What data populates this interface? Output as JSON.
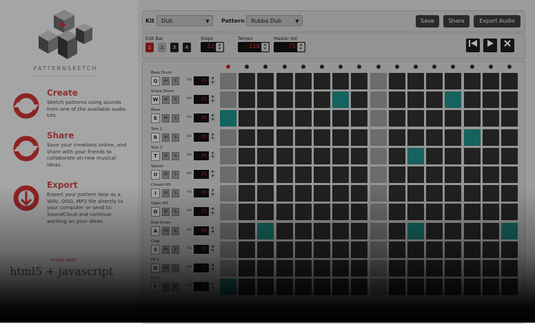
{
  "sidebar": {
    "logo_text": "PATTERNSKETCH",
    "features": [
      {
        "title": "Create",
        "text": "Sketch patterns using sounds from one of the available audio kits.",
        "icon": "cycle-arrows-icon"
      },
      {
        "title": "Share",
        "text": "Save your creations online, and share with your friends to collaborate on new musical ideas.",
        "icon": "share-cycle-icon"
      },
      {
        "title": "Export",
        "text": "Export your pattern loop as a WAV, OGG, MP3 file directly to your computer or send to SoundCloud and continue working on your ideas.",
        "icon": "download-arrow-icon"
      }
    ],
    "made_with": "made with",
    "tech": "html5 + javascript"
  },
  "toolbar": {
    "kit_label": "Kit",
    "kit_value": "Dub",
    "pattern_label": "Pattern",
    "pattern_value": "Rubba Dub",
    "save": "Save",
    "share": "Share",
    "export_audio": "Export Audio"
  },
  "controls": {
    "edit_bar_label": "Edit Bar",
    "bars": [
      "1",
      "2",
      "3",
      "4"
    ],
    "active_bar": "1",
    "steps_label": "Steps",
    "steps": "32",
    "tempo_label": "Tempo",
    "tempo": "110",
    "master_label": "Master Vol",
    "master": "75",
    "transport": [
      "rewind-icon",
      "play-icon",
      "close-icon"
    ]
  },
  "sequencer": {
    "active_step": 1,
    "mute_label": "M",
    "solo_label": "S",
    "vol_label": "Vol",
    "instruments": [
      {
        "name": "Bass Drum",
        "key": "Q",
        "vol": "75"
      },
      {
        "name": "Snare Drum",
        "key": "W",
        "vol": "75"
      },
      {
        "name": "Base",
        "key": "E",
        "vol": "35"
      },
      {
        "name": "Tom 1",
        "key": "R",
        "vol": "75"
      },
      {
        "name": "Tom 2",
        "key": "T",
        "vol": "75"
      },
      {
        "name": "Splash",
        "key": "U",
        "vol": "75"
      },
      {
        "name": "Closed HH",
        "key": "I",
        "vol": "75"
      },
      {
        "name": "Open HH",
        "key": "O",
        "vol": "75"
      },
      {
        "name": "Dub Drum",
        "key": "A",
        "vol": "50"
      },
      {
        "name": "Clap",
        "key": "S",
        "vol": "75"
      },
      {
        "name": "FX 1",
        "key": "D",
        "vol": "75"
      },
      {
        "name": "FX 2",
        "key": "F",
        "vol": "75"
      }
    ],
    "on_cells": [
      [
        1,
        6
      ],
      [
        1,
        12
      ],
      [
        2,
        0
      ],
      [
        3,
        13
      ],
      [
        4,
        10
      ],
      [
        8,
        2
      ],
      [
        8,
        10
      ],
      [
        8,
        15
      ],
      [
        11,
        0
      ]
    ]
  }
}
